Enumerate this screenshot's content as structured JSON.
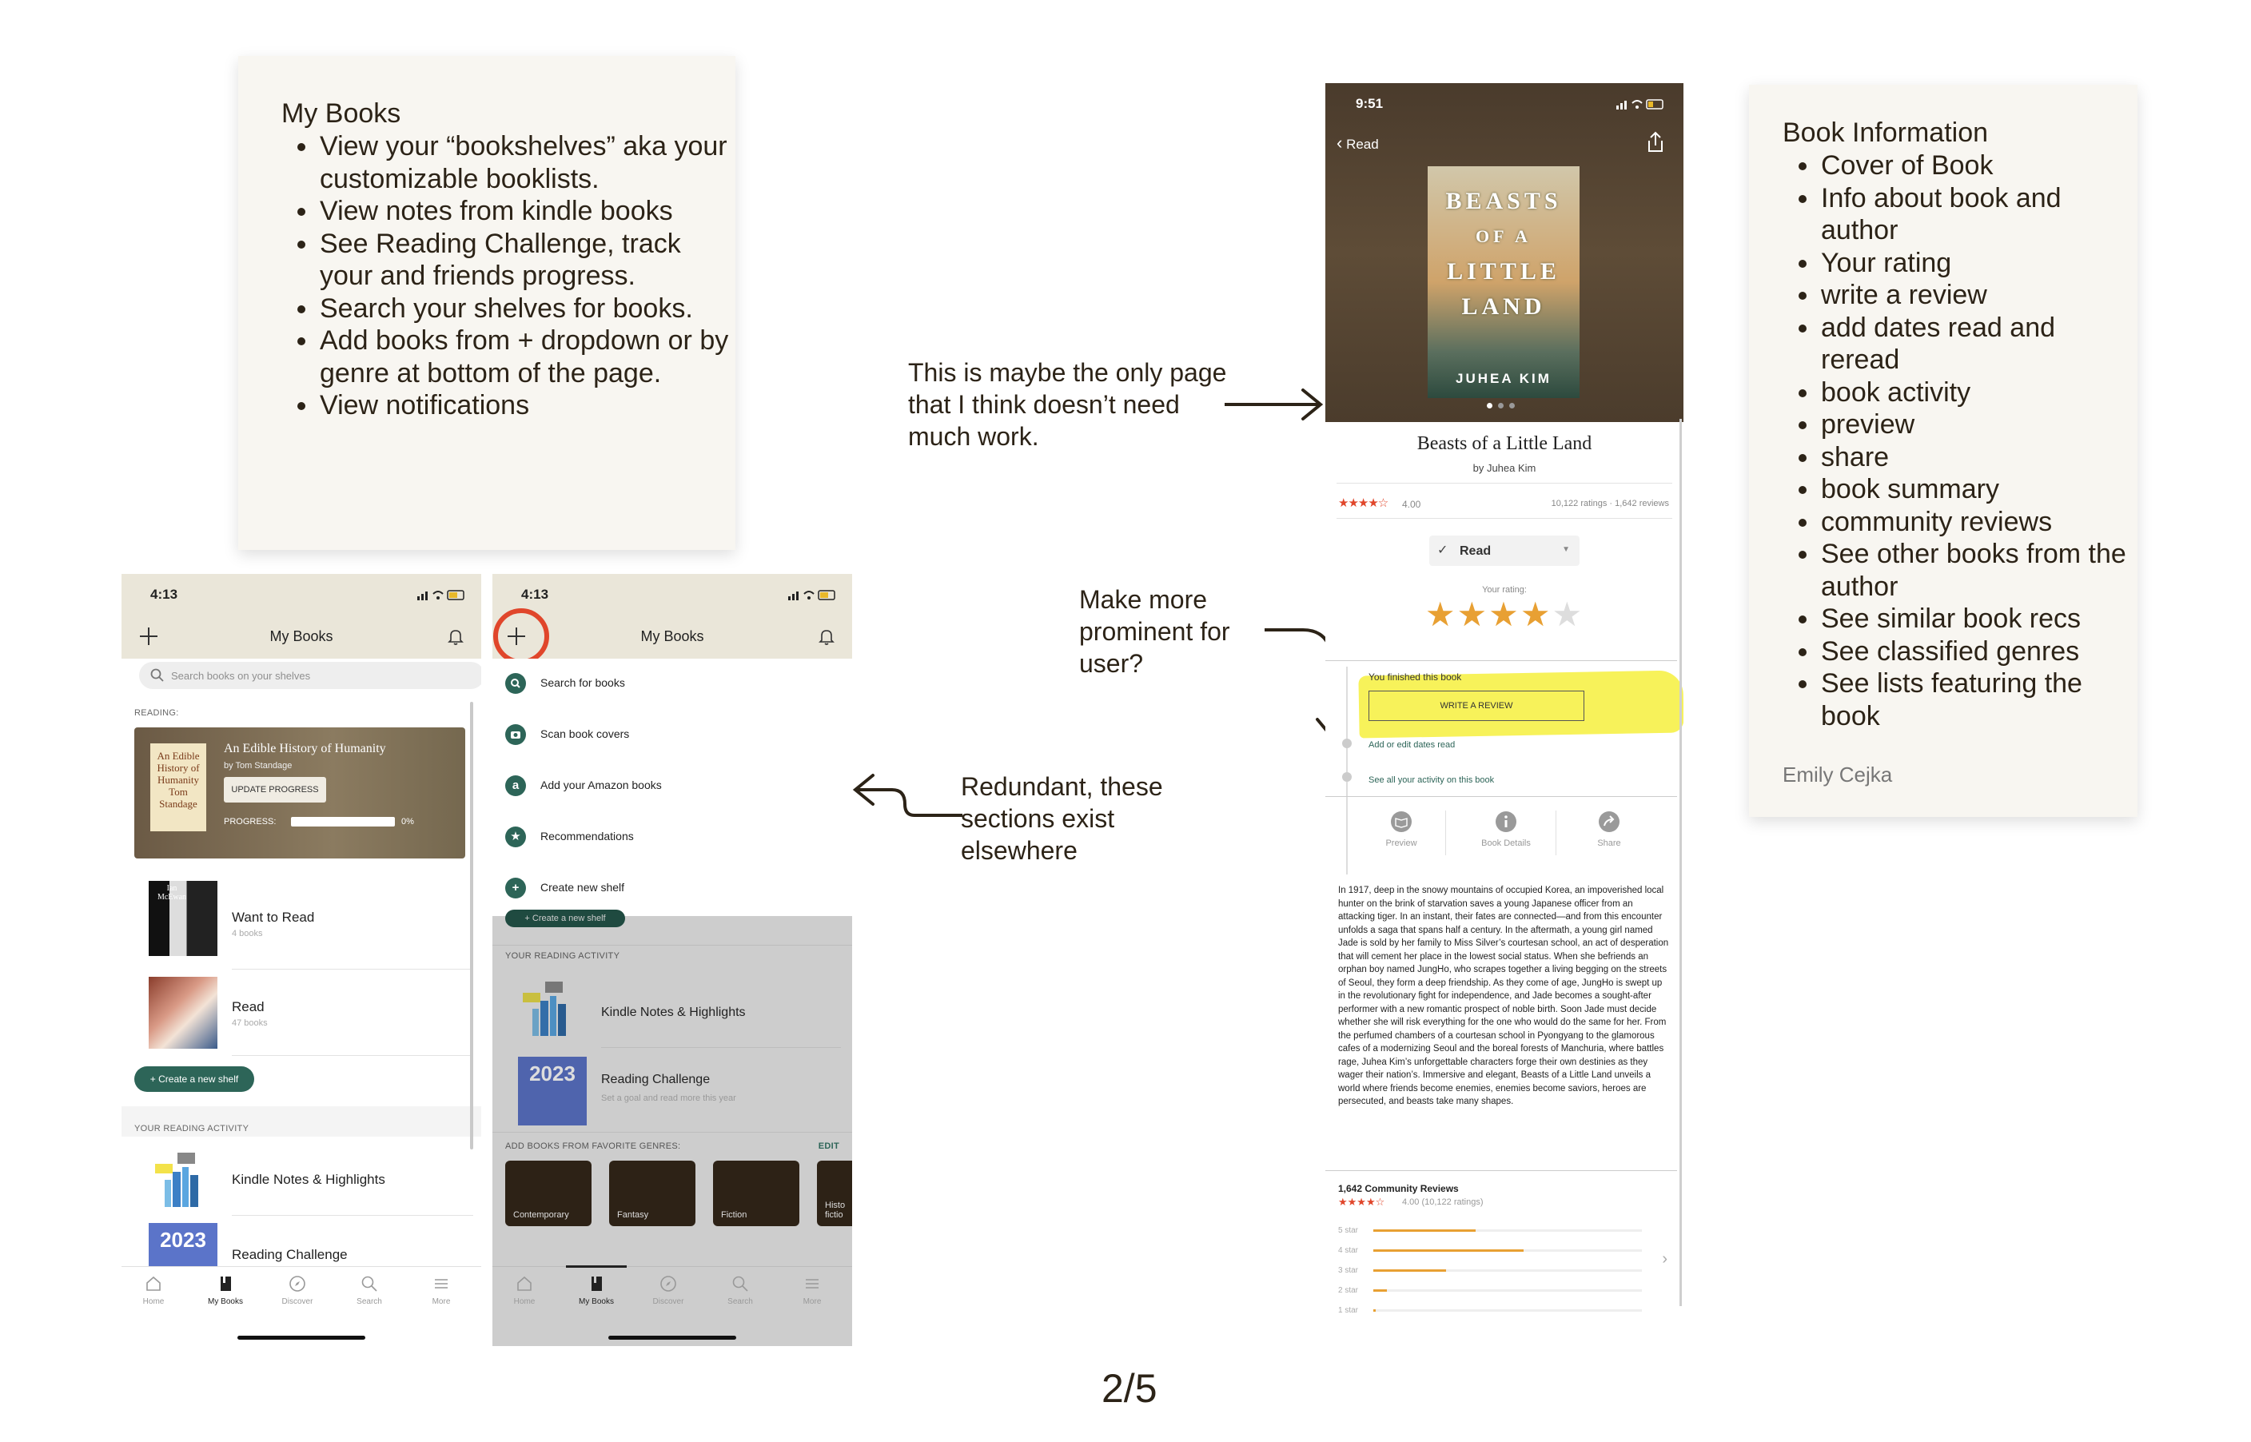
{
  "note_my_books": {
    "title": "My Books",
    "items": [
      "View your “bookshelves” aka your customizable booklists.",
      "View notes from kindle books",
      "See Reading Challenge, track your and friends progress.",
      "Search your shelves for books.",
      "Add books from + dropdown or by genre at bottom of the page.",
      "View notifications"
    ]
  },
  "note_book_info": {
    "title": "Book Information",
    "items": [
      "Cover of Book",
      "Info about book and author",
      "Your rating",
      "write a review",
      "add dates read and reread",
      "book activity",
      "preview",
      "share",
      "book summary",
      "community reviews",
      "See other books from the author",
      "See similar book recs",
      "See classified genres",
      "See lists featuring the book"
    ],
    "author": "Emily Cejka"
  },
  "annotations": {
    "book_page": "This is maybe the only page that I think doesn’t need much work.",
    "prominent": "Make more prominent for user?",
    "redundant": "Redundant, these sections exist elsewhere"
  },
  "page_number": "2/5",
  "phone_my_books": {
    "time": "4:13",
    "title": "My Books",
    "search_placeholder": "Search books on your shelves",
    "reading_label": "READING:",
    "current_book": {
      "title": "An Edible History of Humanity",
      "author": "by Tom Standage",
      "cover_text": "An Edible History of Humanity Tom Standage",
      "update_button": "UPDATE PROGRESS",
      "progress_label": "PROGRESS:",
      "progress_value": "0%",
      "progress_fraction": 0.0
    },
    "shelves": [
      {
        "name": "Want to Read",
        "count": "4 books",
        "cover_text": "Ian McEwan"
      },
      {
        "name": "Read",
        "count": "47 books",
        "cover_text": ""
      }
    ],
    "create_shelf": "+ Create a new shelf",
    "activity_label": "YOUR READING ACTIVITY",
    "activity": [
      {
        "name": "Kindle Notes & Highlights"
      },
      {
        "name": "Reading Challenge",
        "badge": "2023"
      }
    ],
    "tabs": [
      "Home",
      "My Books",
      "Discover",
      "Search",
      "More"
    ]
  },
  "phone_menu": {
    "time": "4:13",
    "title": "My Books",
    "menu_items": [
      {
        "label": "Search for books",
        "icon": "search-icon"
      },
      {
        "label": "Scan book covers",
        "icon": "camera-icon"
      },
      {
        "label": "Add your Amazon books",
        "icon": "amazon-icon"
      },
      {
        "label": "Recommendations",
        "icon": "star-icon"
      },
      {
        "label": "Create new shelf",
        "icon": "plus-icon"
      }
    ],
    "create_shelf_partial": "+ Create a new shelf",
    "activity_label": "YOUR READING ACTIVITY",
    "kindle_label": "Kindle Notes & Highlights",
    "challenge_badge": "2023",
    "challenge_title": "Reading Challenge",
    "challenge_sub": "Set a goal and read more this year",
    "genres_label": "ADD BOOKS FROM FAVORITE GENRES:",
    "edit_label": "EDIT",
    "genres": [
      "Contemporary",
      "Fantasy",
      "Fiction",
      "Histo fictio"
    ],
    "tabs": [
      "Home",
      "My Books",
      "Discover",
      "Search",
      "More"
    ]
  },
  "phone_book": {
    "time": "9:51",
    "back_label": "Read",
    "cover_title": [
      "BEASTS",
      "OF A",
      "LITTLE",
      "LAND"
    ],
    "cover_author": "JUHEA KIM",
    "title": "Beasts of a Little Land",
    "author": "by Juhea Kim",
    "rating": "4.00",
    "rating_value": 4.0,
    "rating_counts": "10,122 ratings · 1,642 reviews",
    "shelf_status": "Read",
    "your_rating_label": "Your rating:",
    "your_rating_value": 4,
    "finished_label": "You finished this book",
    "write_review": "WRITE A REVIEW",
    "dates_link": "Add or edit dates read",
    "activity_link": "See all your activity on this book",
    "actions": [
      "Preview",
      "Book Details",
      "Share"
    ],
    "summary": "In 1917, deep in the snowy mountains of occupied Korea, an impoverished local hunter on the brink of starvation saves a young Japanese officer from an attacking tiger. In an instant, their fates are connected—and from this encounter unfolds a saga that spans half a century. In the aftermath, a young girl named Jade is sold by her family to Miss Silver’s courtesan school, an act of desperation that will cement her place in the lowest social status. When she befriends an orphan boy named JungHo, who scrapes together a living begging on the streets of Seoul, they form a deep friendship. As they come of age, JungHo is swept up in the revolutionary fight for independence, and Jade becomes a sought-after performer with a new romantic prospect of noble birth. Soon Jade must decide whether she will risk everything for the one who would do the same for her. From the perfumed chambers of a courtesan school in Pyongyang to the glamorous cafes of a modernizing Seoul and the boreal forests of Manchuria, where battles rage, Juhea Kim’s unforgettable characters forge their own destinies as they wager their nation’s. Immersive and elegant, Beasts of a Little Land unveils a world where friends become enemies, enemies become saviors, heroes are persecuted, and beasts take many shapes.",
    "community_title": "1,642 Community Reviews",
    "community_rating": "4.00 (10,122 ratings)",
    "star_breakdown": [
      {
        "label": "5 star",
        "fraction": 0.38
      },
      {
        "label": "4 star",
        "fraction": 0.56
      },
      {
        "label": "3 star",
        "fraction": 0.27
      },
      {
        "label": "2 star",
        "fraction": 0.05
      },
      {
        "label": "1 star",
        "fraction": 0.01
      }
    ]
  },
  "colors": {
    "goodreads_green": "#2d6558",
    "highlight_yellow": "#f7f25a",
    "highlight_red": "#e0462b",
    "star_orange": "#e8a033",
    "header_beige": "#eae6d9"
  }
}
